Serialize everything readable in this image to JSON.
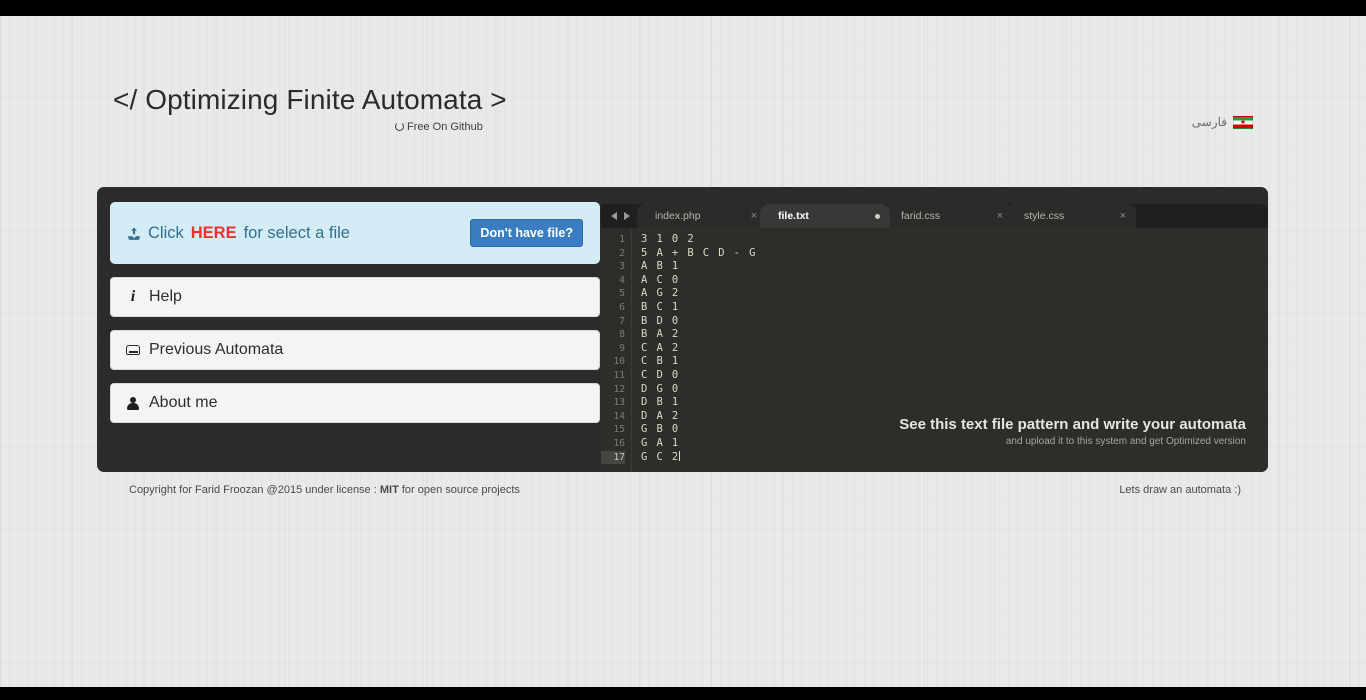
{
  "header": {
    "title": "</ Optimizing Finite Automata >",
    "github_label": "Free On Github",
    "github_icon": "github-icon",
    "language_label": "فارسی",
    "language_flag": "iran-flag-icon"
  },
  "upload": {
    "icon": "upload-icon",
    "text_before": "Click",
    "text_highlight": "HERE",
    "text_after": "for select a file",
    "full_text": "Click HERE for select a file",
    "button_label": "Don't have file?",
    "box_color": "#d4ecf6",
    "text_color": "#31708f",
    "highlight_color": "#f03030",
    "button_color": "#3b7dc1"
  },
  "menu": {
    "items": [
      {
        "label": "Help",
        "icon": "info-icon"
      },
      {
        "label": "Previous Automata",
        "icon": "hdd-icon"
      },
      {
        "label": "About me",
        "icon": "user-icon"
      }
    ]
  },
  "editor": {
    "nav_prev_icon": "arrow-left-icon",
    "nav_next_icon": "arrow-right-icon",
    "tabs": [
      {
        "label": "index.php",
        "active": false,
        "indicator": "close-icon",
        "indicator_glyph": "×"
      },
      {
        "label": "file.txt",
        "active": true,
        "indicator": "unsaved-dot-icon",
        "indicator_glyph": "●"
      },
      {
        "label": "farid.css",
        "active": false,
        "indicator": "close-icon",
        "indicator_glyph": "×"
      },
      {
        "label": "style.css",
        "active": false,
        "indicator": "close-icon",
        "indicator_glyph": "×"
      }
    ],
    "line_numbers": [
      "1",
      "2",
      "3",
      "4",
      "5",
      "6",
      "7",
      "8",
      "9",
      "10",
      "11",
      "12",
      "13",
      "14",
      "15",
      "16",
      "17"
    ],
    "lines": [
      "3 1 0 2",
      "5 A + B C D - G",
      "A B 1",
      "A C 0",
      "A G 2",
      "B C 1",
      "B D 0",
      "B A 2",
      "C A 2",
      "C B 1",
      "C D 0",
      "D G 0",
      "D B 1",
      "D A 2",
      "G B 0",
      "G A 1",
      "G C 2"
    ],
    "cursor_line": 17,
    "hint_title": "See this text file pattern and write your automata",
    "hint_subtitle": "and upload it to this system and get Optimized version"
  },
  "footer": {
    "copyright_before": "Copyright for Farid Froozan @2015 under license : ",
    "copyright_license": "MIT",
    "copyright_after": " for open source projects",
    "tagline": "Lets draw an automata :)"
  }
}
